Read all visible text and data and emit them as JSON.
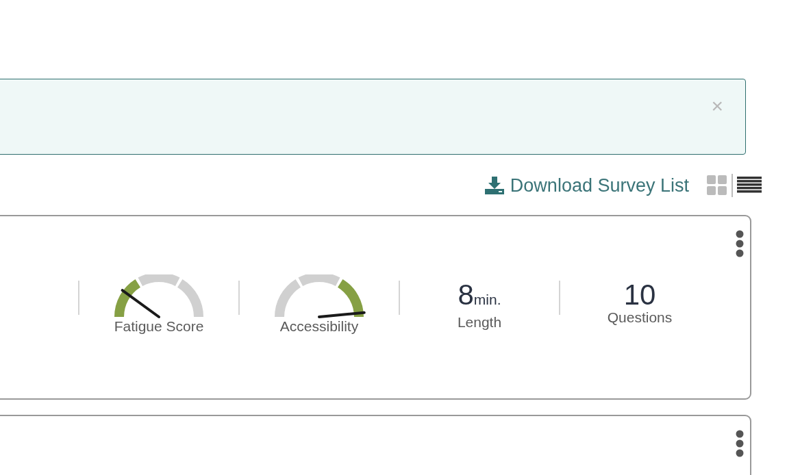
{
  "alert": {
    "close": "×"
  },
  "toolbar": {
    "download_label": "Download Survey List",
    "views": [
      {
        "kind": "grid",
        "selected": false
      },
      {
        "kind": "list",
        "selected": true
      }
    ]
  },
  "cards": [
    {
      "menu": true,
      "stats": [
        {
          "kind": "gauge",
          "label": "Fatigue Score",
          "level": 0.2
        },
        {
          "kind": "gauge",
          "label": "Accessibility",
          "level": 0.97
        },
        {
          "kind": "number",
          "value": "8",
          "unit": "min.",
          "label": "Length"
        },
        {
          "kind": "number",
          "value": "10",
          "label": "Questions"
        }
      ]
    },
    {
      "menu": true
    }
  ]
}
